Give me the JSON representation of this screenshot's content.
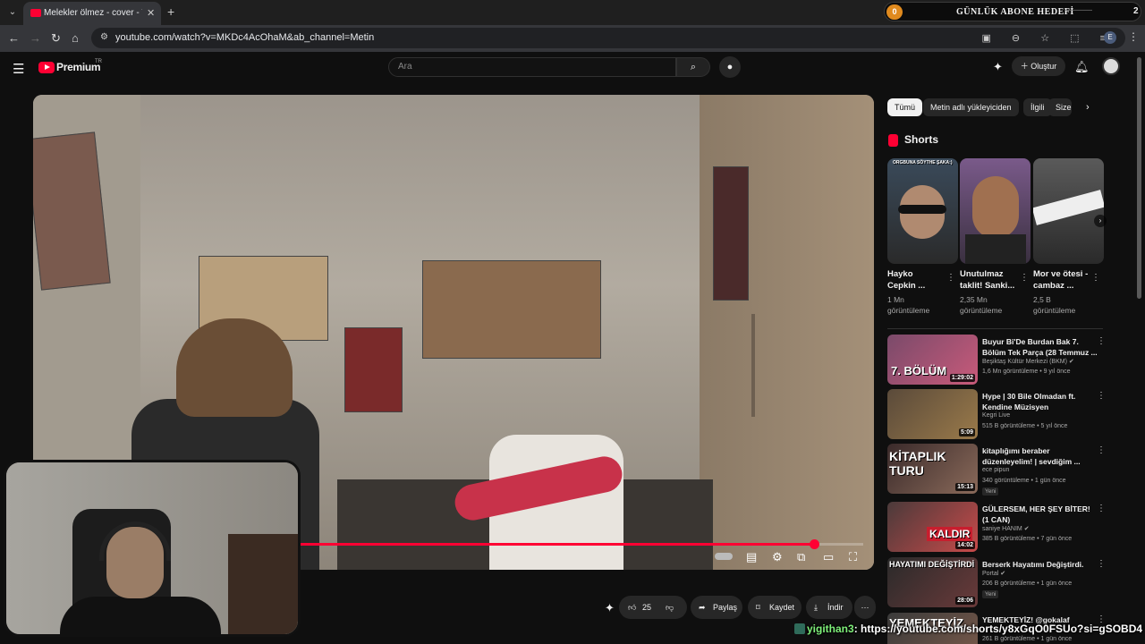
{
  "browser": {
    "tab_title": "Melekler ölmez - cover - YouTube",
    "url": "youtube.com/watch?v=MKDc4AcOhaM&ab_channel=Metin",
    "profile_initial": "E"
  },
  "subscriber_widget": {
    "count": "0",
    "title": "GÜNLÜK ABONE HEDEFİ",
    "goal": "2"
  },
  "yt_header": {
    "brand": "Premium",
    "region": "TR",
    "search_placeholder": "Ara",
    "create_label": "Oluştur"
  },
  "video_actions": {
    "likes": "25",
    "share": "Paylaş",
    "save": "Kaydet",
    "download": "İndir"
  },
  "video_progress": 0.94,
  "chips": [
    "Tümü",
    "Metin adlı yükleyiciden",
    "İlgili",
    "Size ö"
  ],
  "shorts": {
    "heading": "Shorts",
    "items": [
      {
        "title": "Hayko Cepkin ...",
        "views": "1 Mn görüntüleme",
        "overlay": "ORGBUNA SÖYTHE ŞAKA:)"
      },
      {
        "title": "Unutulmaz taklit! Sanki...",
        "views": "2,35 Mn görüntüleme",
        "overlay": ""
      },
      {
        "title": "Mor ve ötesi - cambaz ...",
        "views": "2,5 B görüntüleme",
        "overlay": ""
      }
    ]
  },
  "recommended": [
    {
      "title": "Buyur Bi'De Burdan Bak 7. Bölüm Tek Parça (28 Temmuz ...",
      "channel": "Beşiktaş Kültür Merkezi (BKM)",
      "meta": "1,6 Mn görüntüleme • 9 yıl önce",
      "duration": "1:29:02",
      "thumb_text": "7. BÖLÜM",
      "badge": ""
    },
    {
      "title": "Hype | 30 Bile Olmadan ft. Kendine Müzisyen",
      "channel": "Kegri Live",
      "meta": "515 B görüntüleme • 5 yıl önce",
      "duration": "5:09",
      "thumb_text": "",
      "badge": ""
    },
    {
      "title": "kitaplığımı beraber düzenleyelim! | sevdiğim ...",
      "channel": "ece pipun",
      "meta": "340 görüntüleme • 1 gün önce",
      "duration": "15:13",
      "thumb_text": "KİTAPLIK TURU",
      "badge": "Yeni"
    },
    {
      "title": "GÜLERSEM, HER ŞEY BİTER! (1 CAN)",
      "channel": "saniye HANIM",
      "meta": "385 B görüntüleme • 7 gün önce",
      "duration": "14:02",
      "thumb_text": "KALDIR",
      "badge": ""
    },
    {
      "title": "Berserk Hayatımı Değiştirdi.",
      "channel": "Portal",
      "meta": "206 B görüntüleme • 1 gün önce",
      "duration": "28:06",
      "thumb_text": "HAYATIMI DEĞİŞTİRDİ",
      "badge": "Yeni"
    },
    {
      "title": "YEMEKTEYİZ! @gokalaf",
      "channel": "",
      "meta": "261 B görüntüleme • 1 gün önce",
      "duration": "",
      "thumb_text": "YEMEKTEYİZ",
      "badge": ""
    }
  ],
  "chat": {
    "user": "yigithan3",
    "message": ": https://youtube.com/shorts/y8xGqO0FSUo?si=gSOBD4"
  },
  "colors": {
    "accent": "#ff0033",
    "background": "#0f0f0f",
    "chip_bg": "#272727"
  },
  "icons": [
    "menu-icon",
    "search-icon",
    "mic-icon",
    "notification-icon",
    "like-icon",
    "dislike-icon",
    "share-icon",
    "save-icon",
    "download-icon",
    "settings-icon",
    "fullscreen-icon"
  ]
}
